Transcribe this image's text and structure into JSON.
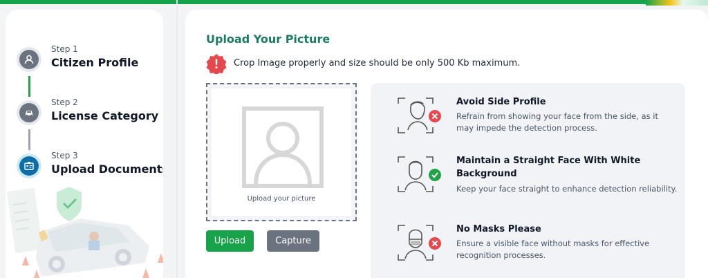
{
  "stepper": {
    "steps": [
      {
        "number": "Step 1",
        "title": "Citizen Profile",
        "icon": "user-icon",
        "state": "done"
      },
      {
        "number": "Step 2",
        "title": "License Category",
        "icon": "car-icon",
        "state": "done"
      },
      {
        "number": "Step 3",
        "title": "Upload Documents",
        "icon": "id-card-icon",
        "state": "active"
      }
    ]
  },
  "main": {
    "title": "Upload Your Picture",
    "warning": "Crop Image properly and size should be only 500 Kb maximum.",
    "dropzone_caption": "Upload your picture",
    "upload_label": "Upload",
    "capture_label": "Capture"
  },
  "tips": [
    {
      "title": "Avoid Side Profile",
      "description": "Refrain from showing your face from the side, as it may impede the detection process.",
      "status": "wrong"
    },
    {
      "title": "Maintain a Straight Face With White Background",
      "description": "Keep your face straight to enhance detection reliability.",
      "status": "correct"
    },
    {
      "title": "No Masks Please",
      "description": "Ensure a visible face without masks for effective recognition processes.",
      "status": "wrong"
    }
  ],
  "colors": {
    "brand_green": "#16a34a",
    "title_green": "#1c7a62",
    "active_step": "#0e6fa6",
    "error_red": "#e5484d",
    "success_green": "#22a34a"
  }
}
